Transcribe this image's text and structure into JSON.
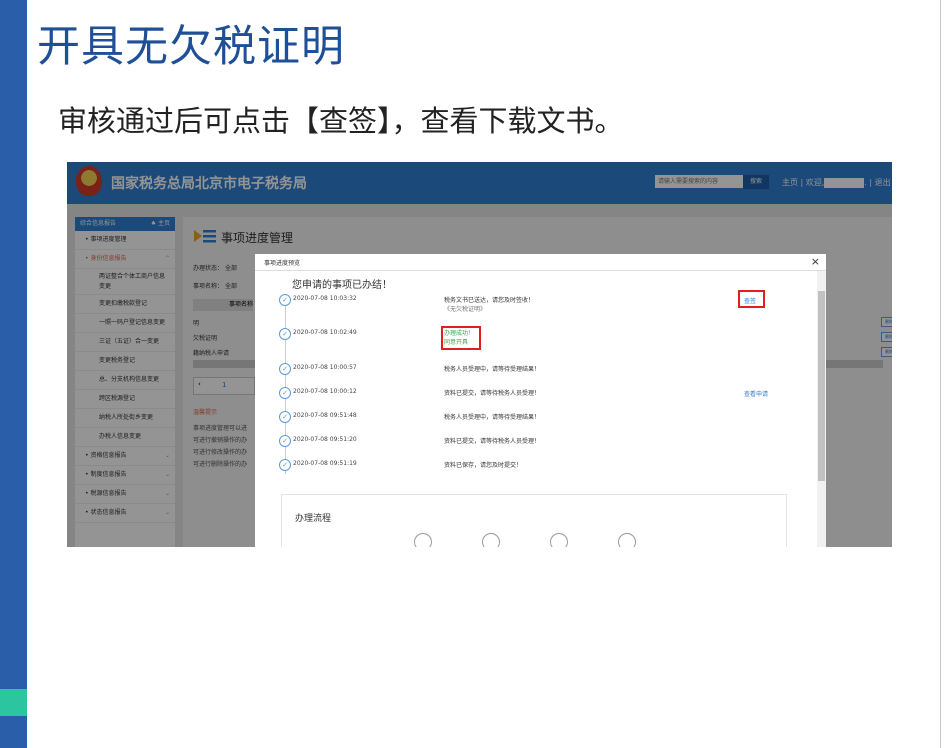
{
  "slide": {
    "title": "开具无欠税证明",
    "subtitle": "审核通过后可点击【查签】，查看下载文书。"
  },
  "app": {
    "site_title": "国家税务总局北京市电子税务局",
    "search_placeholder": "请输入需要搜索的内容",
    "search_button": "搜索",
    "top_links": "主页 | 欢迎,",
    "logout": ". | 退出",
    "colors": {
      "header": "#2f7ed2",
      "accent_red": "#e02020",
      "success_green": "#3aa64a"
    }
  },
  "sidebar": {
    "header": "综合信息报告",
    "home": "主页",
    "items": [
      {
        "label": "事项进度管理",
        "type": "item"
      },
      {
        "label": "身份信息报告",
        "type": "group-open"
      },
      {
        "label": "两证整合个体工商户信息变更",
        "type": "sub2"
      },
      {
        "label": "变更扣缴税款登记",
        "type": "sub"
      },
      {
        "label": "一照一码户登记信息变更",
        "type": "sub"
      },
      {
        "label": "三证（五证）合一变更",
        "type": "sub"
      },
      {
        "label": "变更税务登记",
        "type": "sub"
      },
      {
        "label": "总、分支机构信息变更",
        "type": "sub"
      },
      {
        "label": "跨区税源登记",
        "type": "sub"
      },
      {
        "label": "纳税人所处街乡变更",
        "type": "sub"
      },
      {
        "label": "办税人信息变更",
        "type": "sub"
      },
      {
        "label": "资格信息报告",
        "type": "group"
      },
      {
        "label": "制度信息报告",
        "type": "group"
      },
      {
        "label": "税源信息报告",
        "type": "group"
      },
      {
        "label": "状态信息报告",
        "type": "group"
      }
    ]
  },
  "main": {
    "title": "事项进度管理",
    "filter_status_label": "办理状态：",
    "filter_status_value": "全部",
    "filter_name_label": "事项名称：",
    "filter_name_value": "全部",
    "col_header": "事项名称",
    "rows": [
      "明",
      "欠税证明",
      "籍纳税人申请"
    ],
    "page": "1",
    "tips_title": "温馨提示",
    "tips": [
      "事项进度管理可以进",
      "可进行撤销操作的办",
      "可进行修改操作的办",
      "可进行删除操作的办"
    ],
    "btn_small": "删除"
  },
  "modal": {
    "title": "事项进度预览",
    "close": "×",
    "heading": "您申请的事项已办结！",
    "timeline": [
      {
        "time": "2020-07-08 10:03:32",
        "msg": "税务文书已送达，请您及时签收！",
        "msg2": "《无欠税证明》",
        "action": "查签"
      },
      {
        "time": "2020-07-08 10:02:49",
        "msg": "办理成功！",
        "msg2": "同意开具",
        "action": ""
      },
      {
        "time": "2020-07-08 10:00:57",
        "msg": "税务人员受理中，请等待受理结果！",
        "msg2": "",
        "action": ""
      },
      {
        "time": "2020-07-08 10:00:12",
        "msg": "资料已提交，请等待税务人员受理！",
        "msg2": "",
        "action": "查看申请"
      },
      {
        "time": "2020-07-08 09:51:48",
        "msg": "税务人员受理中，请等待受理结果！",
        "msg2": "",
        "action": ""
      },
      {
        "time": "2020-07-08 09:51:20",
        "msg": "资料已提交，请等待税务人员受理！",
        "msg2": "",
        "action": ""
      },
      {
        "time": "2020-07-08 09:51:19",
        "msg": "资料已保存，请您及时提交！",
        "msg2": "",
        "action": ""
      }
    ],
    "flow_title": "办理流程"
  }
}
